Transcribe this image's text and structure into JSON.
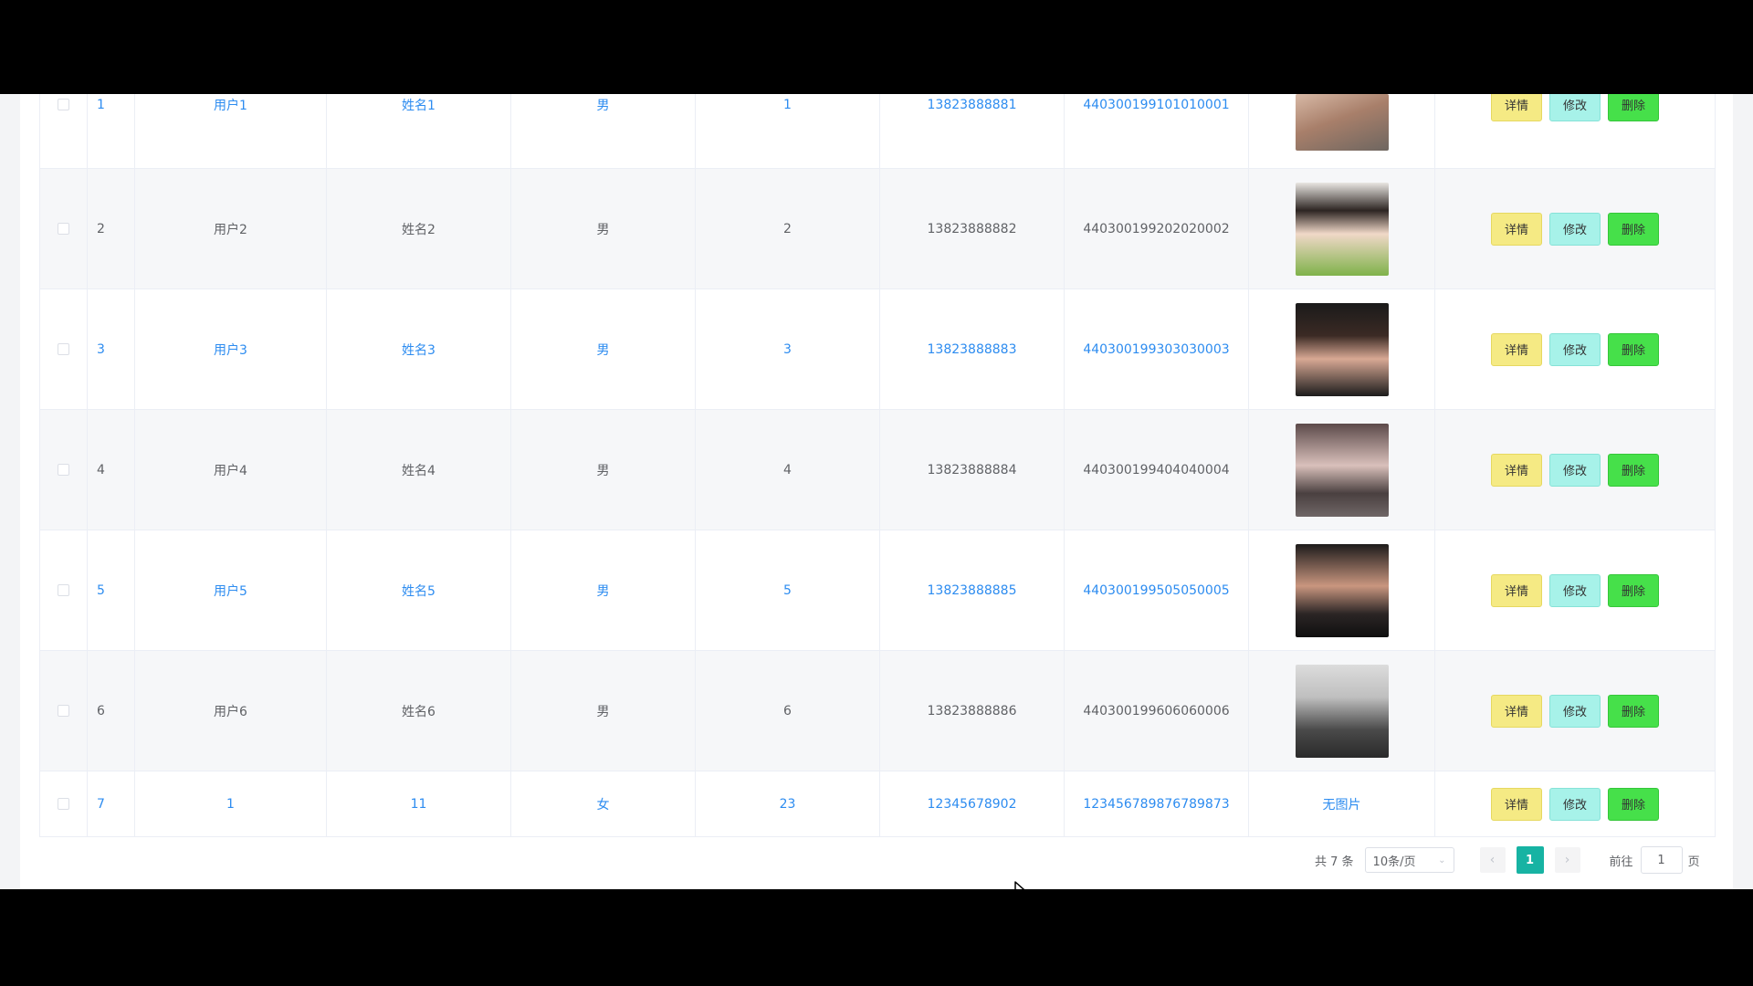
{
  "table": {
    "rows": [
      {
        "idx": "1",
        "username": "用户1",
        "name": "姓名1",
        "gender": "男",
        "age": "1",
        "phone": "13823888881",
        "idcard": "440300199101010001",
        "photo": "person-photo",
        "link": true
      },
      {
        "idx": "2",
        "username": "用户2",
        "name": "姓名2",
        "gender": "男",
        "age": "2",
        "phone": "13823888882",
        "idcard": "440300199202020002",
        "photo": "person-photo",
        "link": false
      },
      {
        "idx": "3",
        "username": "用户3",
        "name": "姓名3",
        "gender": "男",
        "age": "3",
        "phone": "13823888883",
        "idcard": "440300199303030003",
        "photo": "person-photo",
        "link": true
      },
      {
        "idx": "4",
        "username": "用户4",
        "name": "姓名4",
        "gender": "男",
        "age": "4",
        "phone": "13823888884",
        "idcard": "440300199404040004",
        "photo": "person-photo",
        "link": false
      },
      {
        "idx": "5",
        "username": "用户5",
        "name": "姓名5",
        "gender": "男",
        "age": "5",
        "phone": "13823888885",
        "idcard": "440300199505050005",
        "photo": "person-photo",
        "link": true
      },
      {
        "idx": "6",
        "username": "用户6",
        "name": "姓名6",
        "gender": "男",
        "age": "6",
        "phone": "13823888886",
        "idcard": "440300199606060006",
        "photo": "person-photo",
        "link": false
      },
      {
        "idx": "7",
        "username": "1",
        "name": "11",
        "gender": "女",
        "age": "23",
        "phone": "12345678902",
        "idcard": "123456789876789873",
        "photo_text": "无图片",
        "link": true
      }
    ],
    "actions": {
      "detail": "详情",
      "edit": "修改",
      "delete": "删除"
    }
  },
  "pagination": {
    "total": "共 7 条",
    "page_size": "10条/页",
    "current_page": "1",
    "goto_label": "前往",
    "goto_value": "1",
    "page_suffix": "页"
  },
  "colors": {
    "link": "#2d8cf0",
    "active_page": "#17b3a3",
    "detail_button": "#f5ea84",
    "edit_button": "#a7f2e9",
    "delete_button": "#46e04a"
  }
}
